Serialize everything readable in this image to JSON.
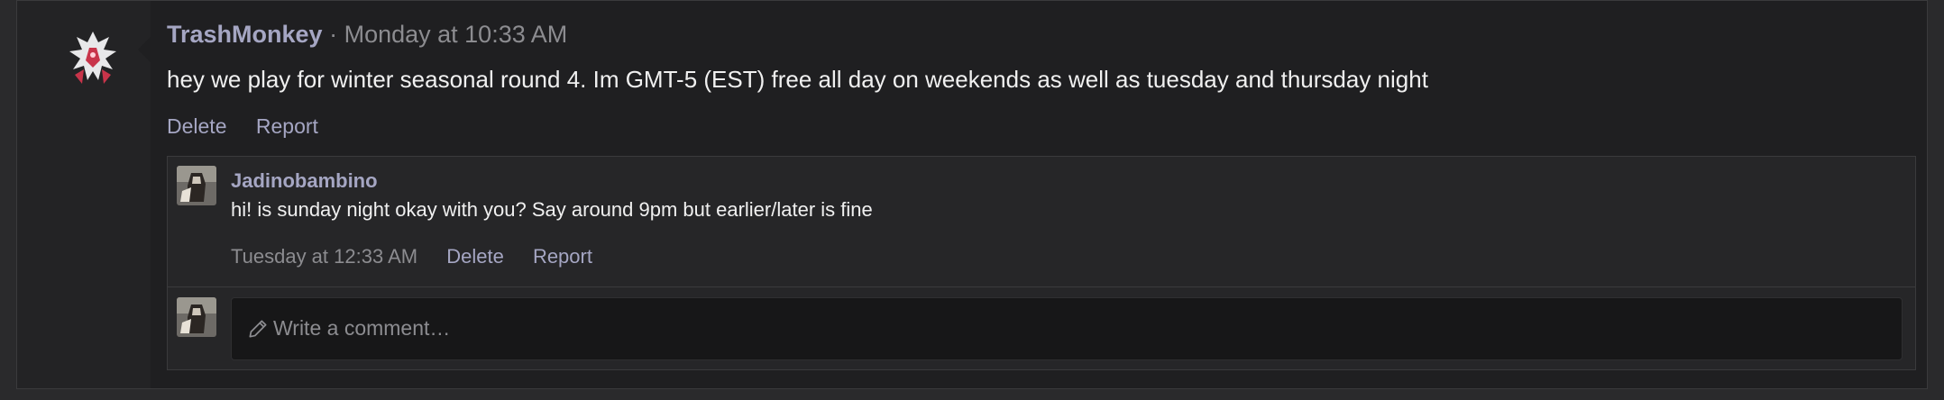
{
  "post": {
    "author": "TrashMonkey",
    "separator": "·",
    "timestamp": "Monday at 10:33 AM",
    "text": "hey we play for winter seasonal round 4. Im GMT-5 (EST) free all day on weekends as well as tuesday and thursday night",
    "actions": {
      "delete": "Delete",
      "report": "Report"
    },
    "avatar_icon": "white-red-dragon-pokemon-avatar"
  },
  "comments": [
    {
      "author": "Jadinobambino",
      "text": "hi! is sunday night okay with you? Say around 9pm but earlier/later is fine",
      "timestamp": "Tuesday at 12:33 AM",
      "actions": {
        "delete": "Delete",
        "report": "Report"
      },
      "avatar_icon": "hooded-figure-avatar"
    }
  ],
  "write_comment": {
    "placeholder": "Write a comment…",
    "icon": "pencil-icon",
    "avatar_icon": "hooded-figure-avatar"
  },
  "colors": {
    "username": "#a5a6c3",
    "text": "#f0f0f0",
    "muted": "#8c8c90",
    "background": "#1f1f21"
  }
}
